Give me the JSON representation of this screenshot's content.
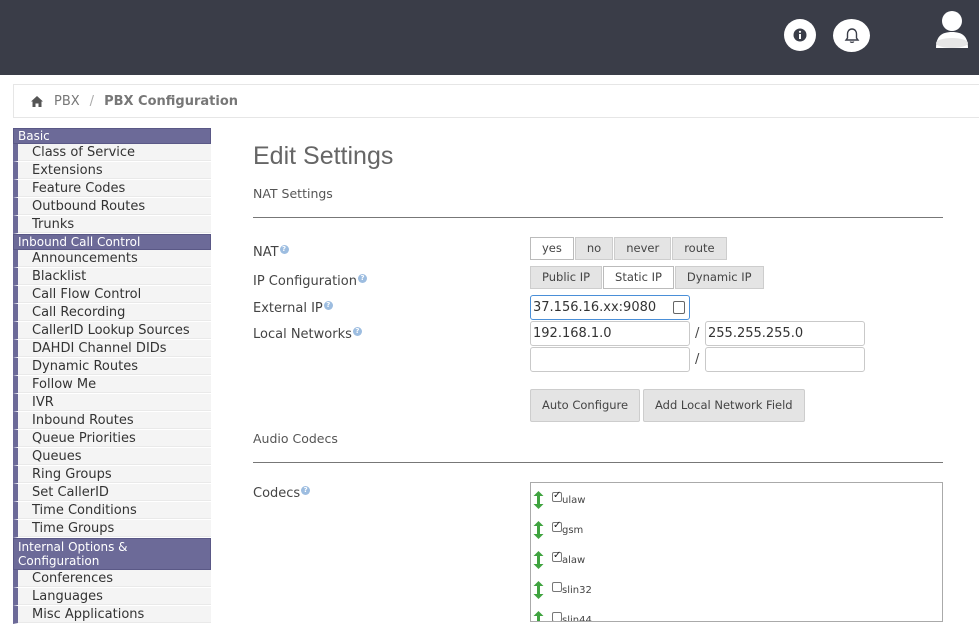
{
  "header": {
    "info_icon": "info-circle-icon",
    "bell_icon": "bell-icon",
    "avatar_icon": "user-avatar-icon"
  },
  "breadcrumb": {
    "home_icon": "home-icon",
    "items": [
      "PBX",
      "PBX Configuration"
    ],
    "separator": "/"
  },
  "sidebar": {
    "sections": [
      {
        "title": "Basic",
        "items": [
          "Class of Service",
          "Extensions",
          "Feature Codes",
          "Outbound Routes",
          "Trunks"
        ]
      },
      {
        "title": "Inbound Call Control",
        "items": [
          "Announcements",
          "Blacklist",
          "Call Flow Control",
          "Call Recording",
          "CallerID Lookup Sources",
          "DAHDI Channel DIDs",
          "Dynamic Routes",
          "Follow Me",
          "IVR",
          "Inbound Routes",
          "Queue Priorities",
          "Queues",
          "Ring Groups",
          "Set CallerID",
          "Time Conditions",
          "Time Groups"
        ]
      },
      {
        "title": "Internal Options & Configuration",
        "items": [
          "Conferences",
          "Languages",
          "Misc Applications"
        ]
      }
    ]
  },
  "main": {
    "title": "Edit Settings",
    "nat_section": "NAT Settings",
    "audio_section": "Audio Codecs",
    "help_glyph": "?",
    "nat": {
      "label": "NAT",
      "options": [
        "yes",
        "no",
        "never",
        "route"
      ],
      "selected": "yes"
    },
    "ip_config": {
      "label": "IP Configuration",
      "options": [
        "Public IP",
        "Static IP",
        "Dynamic IP"
      ],
      "selected": "Static IP"
    },
    "external_ip": {
      "label": "External IP",
      "value": "37.156.16.xx:9080"
    },
    "local_networks": {
      "label": "Local Networks",
      "rows": [
        {
          "network": "192.168.1.0",
          "mask": "255.255.255.0"
        },
        {
          "network": "",
          "mask": ""
        }
      ],
      "separator": "/"
    },
    "buttons": {
      "auto_configure": "Auto Configure",
      "add_local_network": "Add Local Network Field"
    },
    "codecs": {
      "label": "Codecs",
      "items": [
        {
          "name": "ulaw",
          "checked": true
        },
        {
          "name": "gsm",
          "checked": true
        },
        {
          "name": "alaw",
          "checked": true
        },
        {
          "name": "slin32",
          "checked": false
        },
        {
          "name": "slin44",
          "checked": false
        }
      ]
    }
  }
}
